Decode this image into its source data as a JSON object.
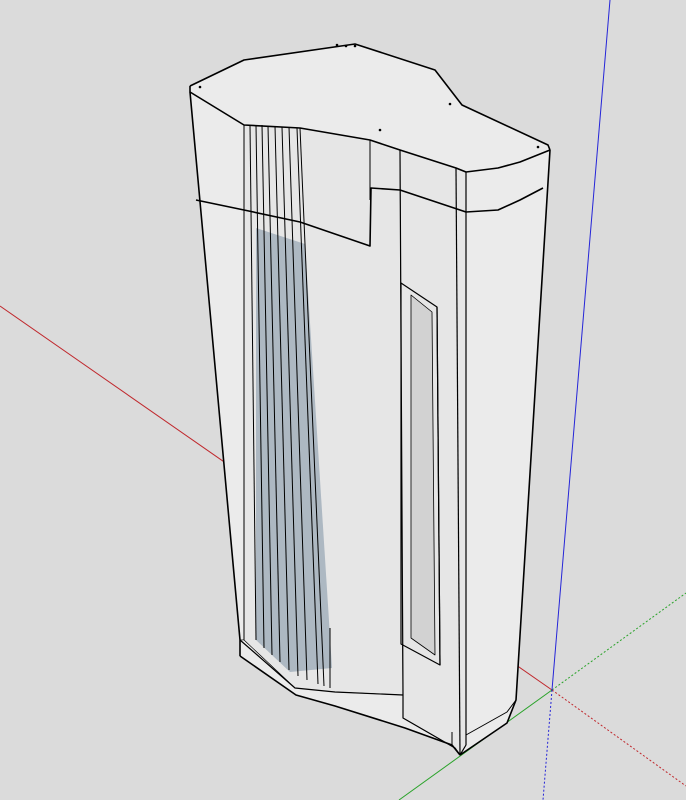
{
  "viewport": {
    "background_color": "#dbdbdb",
    "axes": {
      "red_color": "#c0282d",
      "green_color": "#2aa32a",
      "blue_color": "#2525d8"
    }
  },
  "model": {
    "face_color": "#ebebeb",
    "front_face_color": "#e6e6e6",
    "edge_color": "#000000",
    "slot_inner_color": "#d2d2d2",
    "ribs_fill_color": "#adb8c2"
  }
}
